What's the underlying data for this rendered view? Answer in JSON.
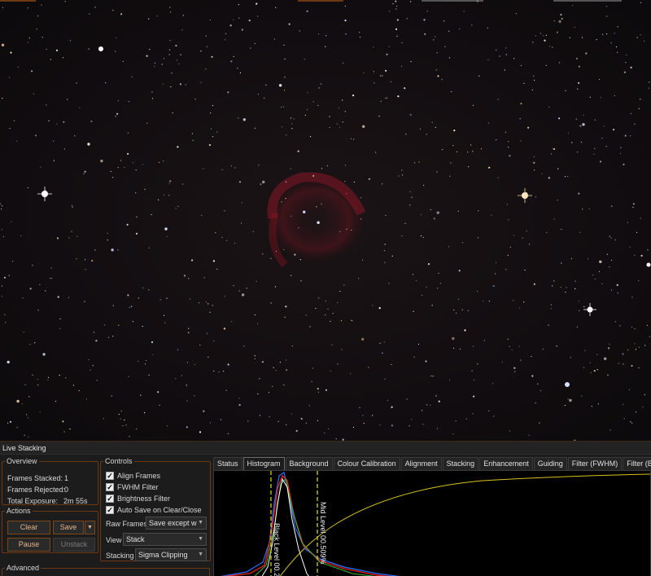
{
  "window": {
    "title": "Live Stacking"
  },
  "colors": {
    "accent": "#7a4818",
    "histogram_red": "#e0201c",
    "histogram_blue": "#2a6fff",
    "histogram_white": "#ffffff",
    "curve_yellow": "#d6c21e",
    "level_line": "#e6e000"
  },
  "overview": {
    "legend": "Overview",
    "frames_stacked_label": "Frames Stacked:",
    "frames_stacked": "1",
    "frames_rejected_label": "Frames Rejected:",
    "frames_rejected": "0",
    "total_exposure_label": "Total Exposure:",
    "total_exposure": "2m 55s"
  },
  "actions": {
    "legend": "Actions",
    "clear": "Clear",
    "save": "Save",
    "save_menu_icon": "chevron-down",
    "pause": "Pause",
    "unstack": "Unstack"
  },
  "advanced": {
    "legend": "Advanced"
  },
  "controls": {
    "legend": "Controls",
    "checkboxes": [
      {
        "label": "Align Frames",
        "checked": true
      },
      {
        "label": "FWHM Filter",
        "checked": true
      },
      {
        "label": "Brightness Filter",
        "checked": true
      },
      {
        "label": "Auto Save on Clear/Close",
        "checked": true
      }
    ],
    "raw_frames_label": "Raw Frames",
    "raw_frames_value": "Save except w",
    "view_label": "View",
    "view_value": "Stack",
    "stacking_label": "Stacking",
    "stacking_value": "Sigma Clipping"
  },
  "tabs": [
    {
      "label": "Status",
      "active": false
    },
    {
      "label": "Histogram",
      "active": true
    },
    {
      "label": "Background",
      "active": false
    },
    {
      "label": "Colour Calibration",
      "active": false
    },
    {
      "label": "Alignment",
      "active": false
    },
    {
      "label": "Stacking",
      "active": false
    },
    {
      "label": "Enhancement",
      "active": false
    },
    {
      "label": "Guiding",
      "active": false
    },
    {
      "label": "Filter (FWHM)",
      "active": false
    },
    {
      "label": "Filter (Brightne",
      "active": false
    }
  ],
  "histogram": {
    "black_level_label": "Black Level 00.2",
    "mid_level_label": "Mid Level 00.509%"
  }
}
